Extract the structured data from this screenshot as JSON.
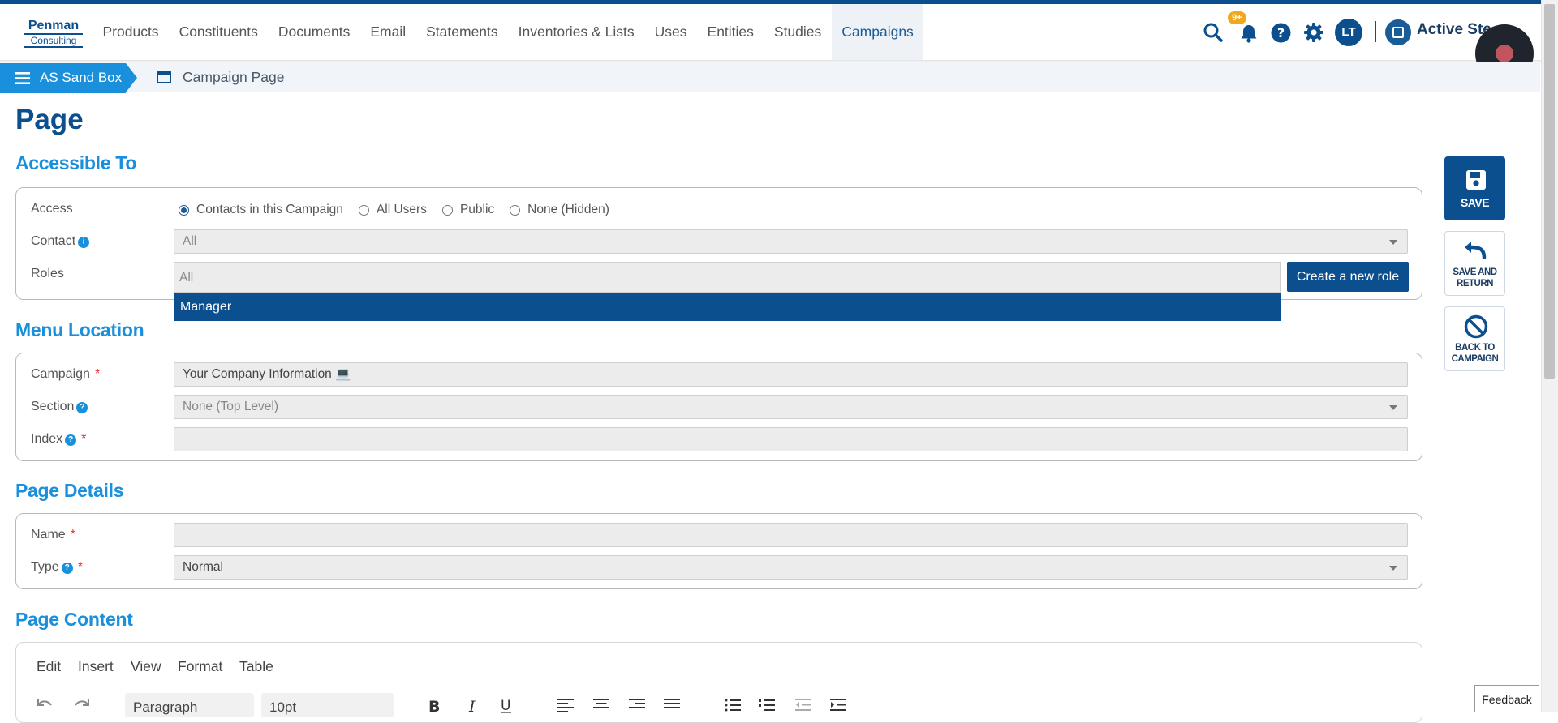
{
  "logo": {
    "line1": "Penman",
    "line2": "Consulting"
  },
  "nav": {
    "items": [
      "Products",
      "Constituents",
      "Documents",
      "Email",
      "Statements",
      "Inventories & Lists",
      "Uses",
      "Entities",
      "Studies",
      "Campaigns"
    ],
    "active": "Campaigns",
    "notification_badge": "9+",
    "avatar_initials": "LT",
    "org_name": "Active Ste"
  },
  "breadcrumb": {
    "root": "AS Sand Box",
    "current": "Campaign Page"
  },
  "page_title": "Page",
  "accessible_to": {
    "heading": "Accessible To",
    "access_label": "Access",
    "access_options": [
      "Contacts in this Campaign",
      "All Users",
      "Public",
      "None (Hidden)"
    ],
    "access_selected": "Contacts in this Campaign",
    "contact_label": "Contact",
    "contact_value": "All",
    "roles_label": "Roles",
    "roles_placeholder": "All",
    "create_role_button": "Create a new role",
    "roles_dropdown_option": "Manager"
  },
  "menu_location": {
    "heading": "Menu Location",
    "campaign_label": "Campaign",
    "campaign_value": "Your Company Information 💻",
    "section_label": "Section",
    "section_value": "None (Top Level)",
    "index_label": "Index",
    "index_value": ""
  },
  "page_details": {
    "heading": "Page Details",
    "name_label": "Name",
    "name_value": "",
    "type_label": "Type",
    "type_value": "Normal"
  },
  "page_content": {
    "heading": "Page Content",
    "editor_menu": [
      "Edit",
      "Insert",
      "View",
      "Format",
      "Table"
    ],
    "block_format": "Paragraph",
    "font_size": "10pt"
  },
  "side_actions": {
    "save": "SAVE",
    "save_return_line1": "SAVE AND",
    "save_return_line2": "RETURN",
    "back_line1": "BACK TO",
    "back_line2": "CAMPAIGN"
  },
  "feedback": "Feedback",
  "colors": {
    "brand_dark": "#0b4f8f",
    "accent_blue": "#1a8fdc",
    "required": "#e03030"
  }
}
